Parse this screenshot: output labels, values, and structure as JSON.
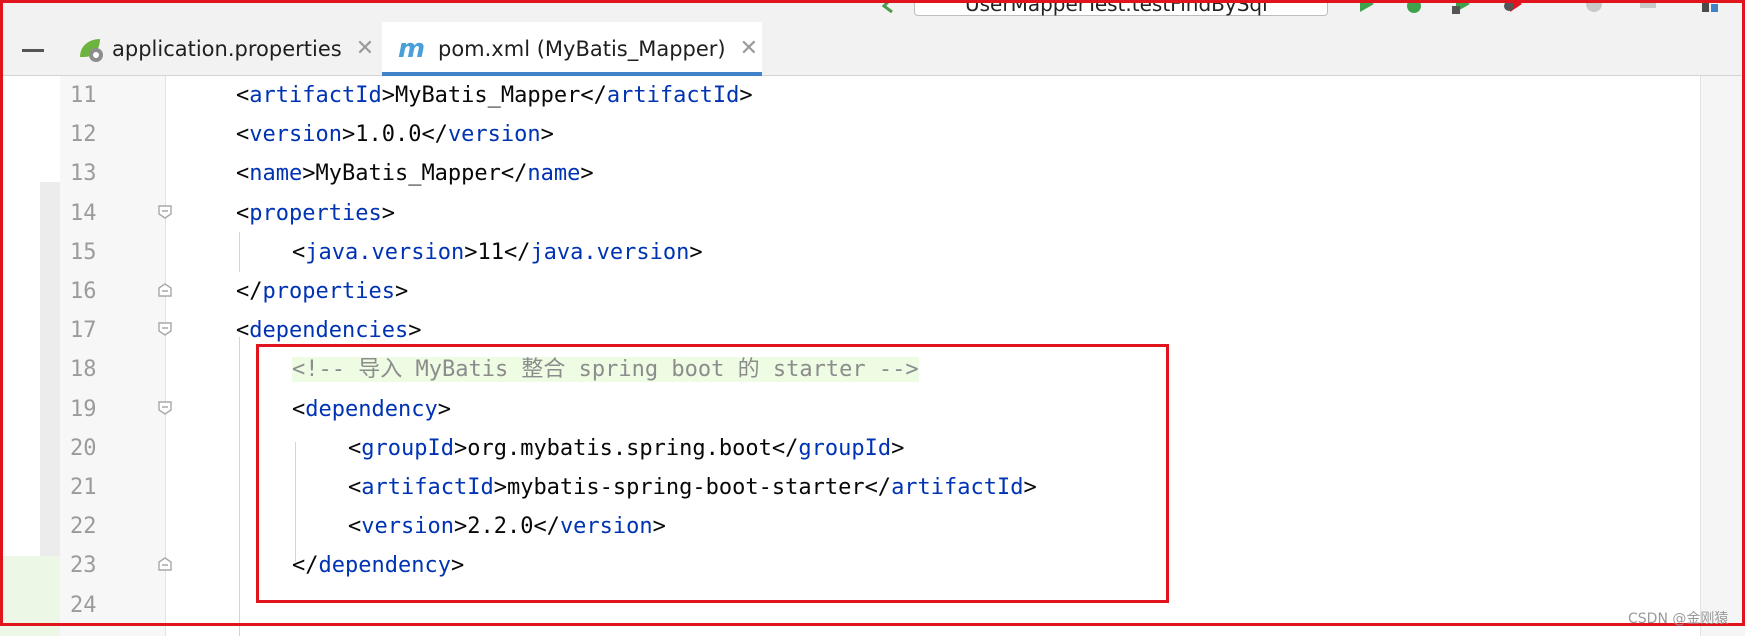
{
  "toolbar": {
    "run_config": "UserMapperTest.testFindBySql"
  },
  "tabs": [
    {
      "label": "application.properties",
      "icon": "spring-properties-icon",
      "active": false
    },
    {
      "label": "pom.xml (MyBatis_Mapper)",
      "icon": "maven-icon",
      "active": true
    }
  ],
  "editor": {
    "lines": [
      {
        "number": "11",
        "tokens": [
          [
            "t",
            "<"
          ],
          [
            "tag",
            "artifactId"
          ],
          [
            "t",
            ">MyBatis_Mapper</"
          ],
          [
            "tag",
            "artifactId"
          ],
          [
            "t",
            ">"
          ]
        ]
      },
      {
        "number": "12",
        "tokens": [
          [
            "t",
            "<"
          ],
          [
            "tag",
            "version"
          ],
          [
            "t",
            ">1.0.0</"
          ],
          [
            "tag",
            "version"
          ],
          [
            "t",
            ">"
          ]
        ]
      },
      {
        "number": "13",
        "tokens": [
          [
            "t",
            "<"
          ],
          [
            "tag",
            "name"
          ],
          [
            "t",
            ">MyBatis_Mapper</"
          ],
          [
            "tag",
            "name"
          ],
          [
            "t",
            ">"
          ]
        ]
      },
      {
        "number": "14",
        "tokens": [
          [
            "t",
            "<"
          ],
          [
            "tag",
            "properties"
          ],
          [
            "t",
            ">"
          ]
        ]
      },
      {
        "number": "15",
        "tokens": [
          [
            "t",
            "<"
          ],
          [
            "tag",
            "java.version"
          ],
          [
            "t",
            ">11</"
          ],
          [
            "tag",
            "java.version"
          ],
          [
            "t",
            ">"
          ]
        ]
      },
      {
        "number": "16",
        "tokens": [
          [
            "t",
            "</"
          ],
          [
            "tag",
            "properties"
          ],
          [
            "t",
            ">"
          ]
        ]
      },
      {
        "number": "17",
        "tokens": [
          [
            "t",
            "<"
          ],
          [
            "tag",
            "dependencies"
          ],
          [
            "t",
            ">"
          ]
        ]
      },
      {
        "number": "18",
        "tokens": [
          [
            "comment",
            "<!-- 导入 MyBatis 整合 spring boot 的 starter -->"
          ]
        ]
      },
      {
        "number": "19",
        "tokens": [
          [
            "t",
            "<"
          ],
          [
            "tag",
            "dependency"
          ],
          [
            "t",
            ">"
          ]
        ]
      },
      {
        "number": "20",
        "tokens": [
          [
            "t",
            "<"
          ],
          [
            "tag",
            "groupId"
          ],
          [
            "t",
            ">org.mybatis.spring.boot</"
          ],
          [
            "tag",
            "groupId"
          ],
          [
            "t",
            ">"
          ]
        ]
      },
      {
        "number": "21",
        "tokens": [
          [
            "t",
            "<"
          ],
          [
            "tag",
            "artifactId"
          ],
          [
            "t",
            ">mybatis-spring-boot-starter</"
          ],
          [
            "tag",
            "artifactId"
          ],
          [
            "t",
            ">"
          ]
        ]
      },
      {
        "number": "22",
        "tokens": [
          [
            "t",
            "<"
          ],
          [
            "tag",
            "version"
          ],
          [
            "t",
            ">2.2.0</"
          ],
          [
            "tag",
            "version"
          ],
          [
            "t",
            ">"
          ]
        ]
      },
      {
        "number": "23",
        "tokens": [
          [
            "t",
            "</"
          ],
          [
            "tag",
            "dependency"
          ],
          [
            "t",
            ">"
          ]
        ]
      },
      {
        "number": "24",
        "tokens": []
      }
    ]
  },
  "watermark": "CSDN @金刚猿",
  "colors": {
    "tag": "#0033b3",
    "comment": "#8c8c8c",
    "highlight_border": "#e0141d",
    "active_tab_underline": "#4083c9"
  }
}
